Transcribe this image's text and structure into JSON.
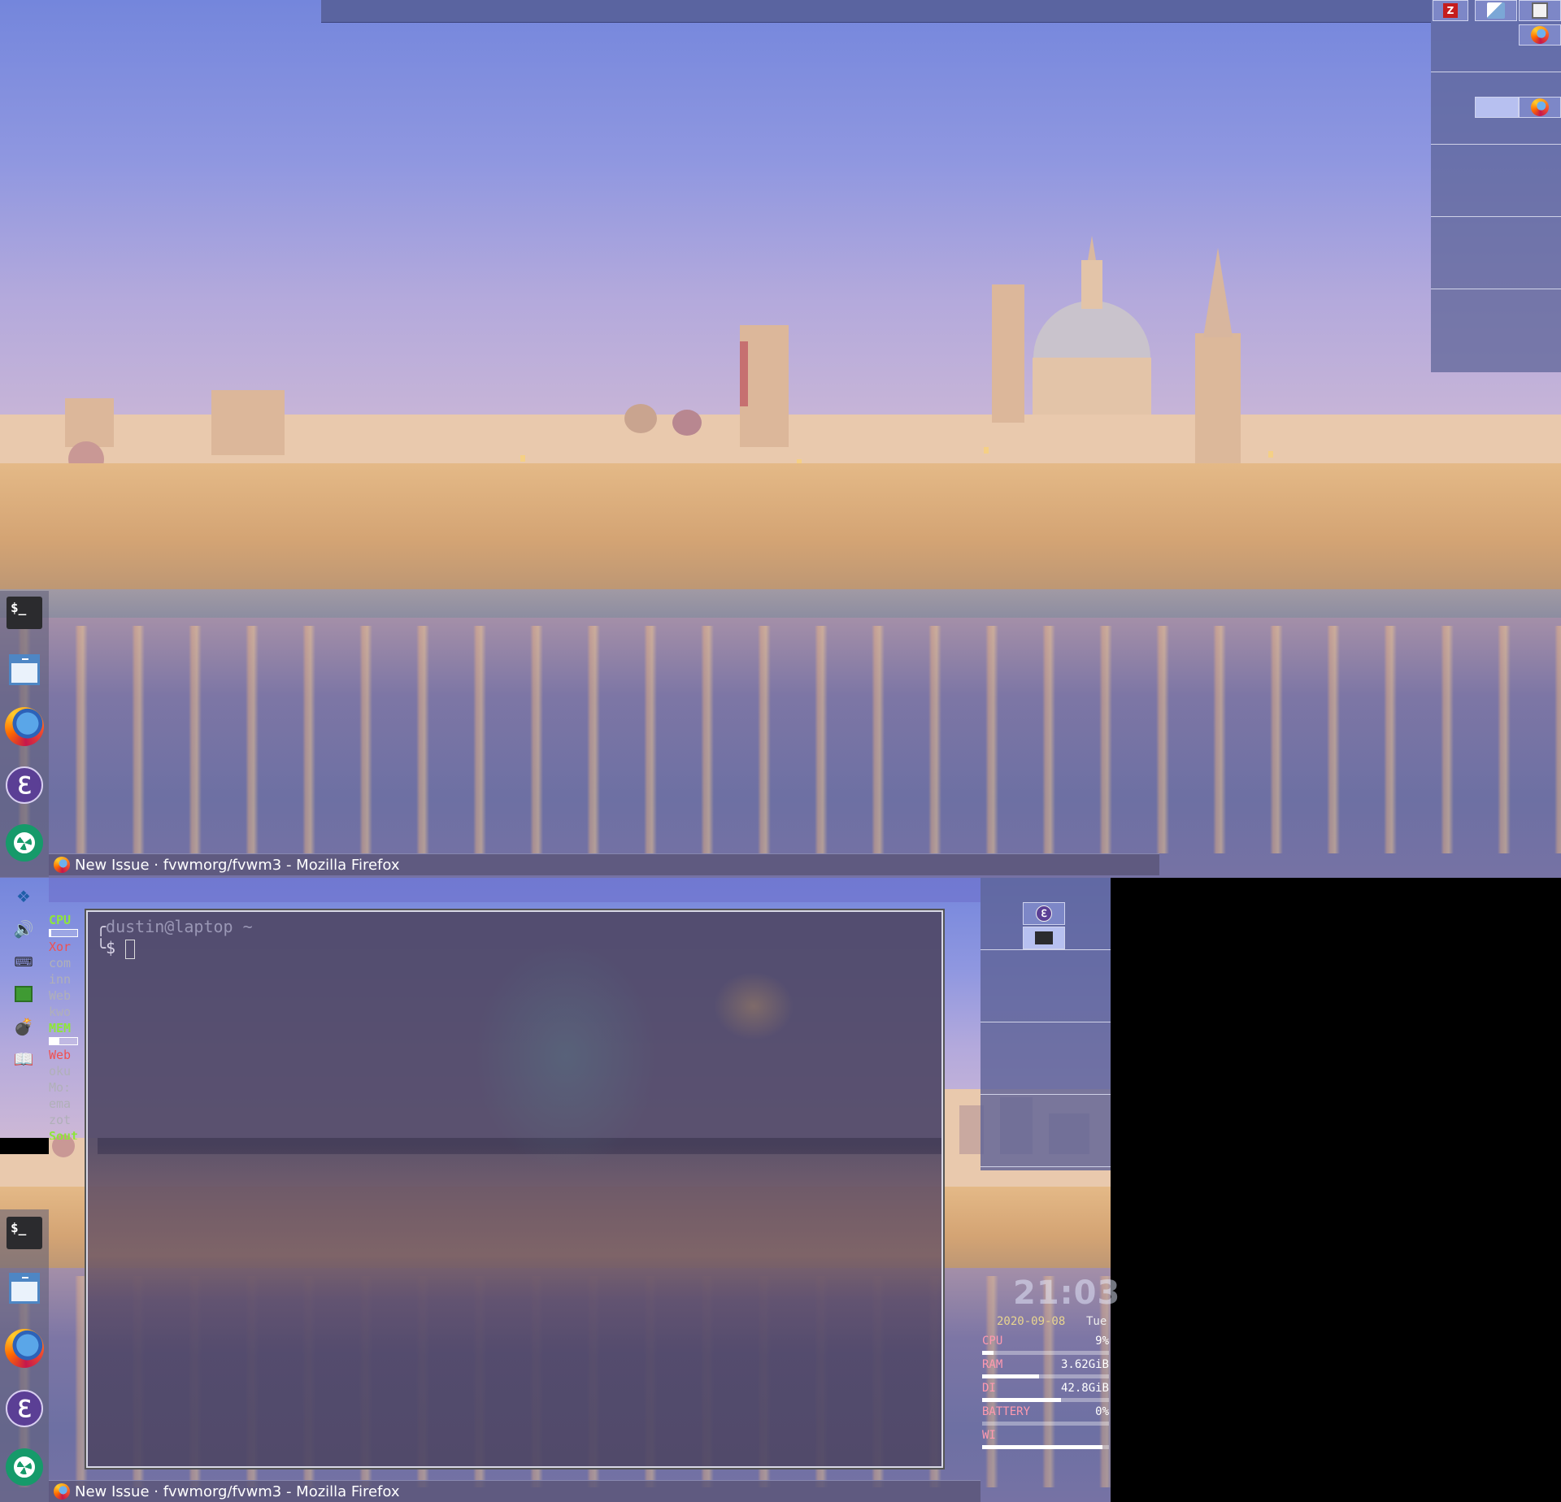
{
  "top_firefox_title": "New Issue · fvwmorg/fvwm3 - Mozilla Firefox",
  "bottom_firefox_title": "New Issue · fvwmorg/fvwm3 - Mozilla Firefox",
  "dock_icons": [
    "terminal-icon",
    "window-icon",
    "firefox-icon",
    "emacs-icon",
    "shutter-icon"
  ],
  "pager_icons": [
    "zotero-icon",
    "okular-icon",
    "book-icon",
    "firefox-icon"
  ],
  "tray_icons": [
    "dropbox-icon",
    "volume-icon",
    "keyboard-icon",
    "virtualbox-icon",
    "bomb-icon",
    "book-icon"
  ],
  "conky_left": {
    "cpu_header": "CPU",
    "cpu_procs": [
      "Xor",
      "com",
      "inn",
      "Web",
      "kwo"
    ],
    "mem_header": "MEM",
    "mem_procs": [
      "Web",
      "oku",
      "Mo:",
      "ema",
      "zot"
    ],
    "footer": "Sout",
    "cpu_level": 0.05,
    "mem_level": 0.35
  },
  "terminal": {
    "prompt_user": "dustin@laptop ~",
    "prompt_box_top": "╭",
    "prompt_box_bottom": "╰",
    "prompt_symbol": "$"
  },
  "dock_terminal_text": "$_",
  "pager_bottom_icons": [
    "emacs-icon",
    "terminal-icon"
  ],
  "conky_right": {
    "clock": "21:03",
    "date": "2020-09-08",
    "day": "Tue",
    "rows": [
      {
        "label": "CPU",
        "value": "9%",
        "level": 0.09
      },
      {
        "label": "RAM",
        "value": "3.62GiB",
        "level": 0.45
      },
      {
        "label": "DI",
        "value": "42.8GiB",
        "level": 0.62
      },
      {
        "label": "BATTERY",
        "value": "0%",
        "level": 0.0
      },
      {
        "label": "WI",
        "value": "",
        "level": 0.95
      }
    ]
  },
  "colors": {
    "conky_green": "#8ee63a",
    "conky_pink": "#ff9ab0",
    "pager_blue": "#5a64a0"
  }
}
